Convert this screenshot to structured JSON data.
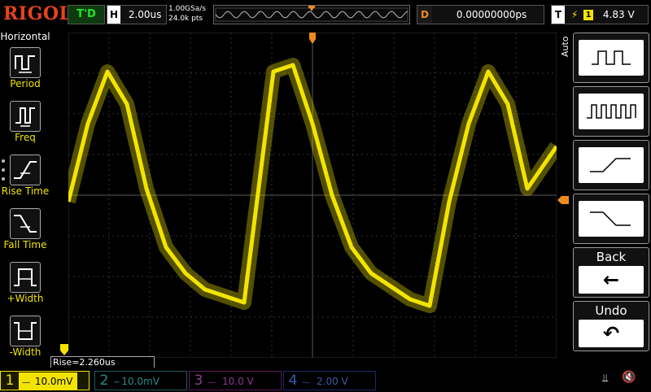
{
  "brand": "RIGOL",
  "status": "T'D",
  "horizontal": {
    "letter": "H",
    "timebase": "2.00us",
    "sample_rate": "1.00GSa/s",
    "points": "24.0k pts"
  },
  "delay": {
    "letter": "D",
    "value": "0.00000000ps"
  },
  "trigger": {
    "letter": "T",
    "edge": "⚡",
    "channel": "1",
    "level": "4.83 V",
    "marker": "T"
  },
  "left_menu": {
    "title": "Horizontal",
    "items": [
      {
        "label": "Period"
      },
      {
        "label": "Freq"
      },
      {
        "label": "Rise Time"
      },
      {
        "label": "Fall Time"
      },
      {
        "label": "+Width"
      },
      {
        "label": "-Width"
      }
    ]
  },
  "right_menu": {
    "mode_label": "Auto",
    "back_label": "Back",
    "undo_label": "Undo",
    "back_icon": "left-arrow-icon",
    "undo_icon": "undo-icon"
  },
  "measurement": "Rise=2.260us",
  "channels": [
    {
      "num": "1",
      "coupling": "—",
      "scale": "10.0mV",
      "color": "#f2e400"
    },
    {
      "num": "2",
      "coupling": "~",
      "scale": "10.0mV",
      "color": "#2a8a8a"
    },
    {
      "num": "3",
      "coupling": "—",
      "scale": "10.0 V",
      "color": "#8a3a8a"
    },
    {
      "num": "4",
      "coupling": "—",
      "scale": "2.00 V",
      "color": "#3a5aaa"
    }
  ],
  "waveform": {
    "color": "#f2e400",
    "shape": "triangle-like with rounded peaks",
    "samples": [
      [
        0,
        0.52
      ],
      [
        0.04,
        0.28
      ],
      [
        0.08,
        0.12
      ],
      [
        0.12,
        0.22
      ],
      [
        0.16,
        0.48
      ],
      [
        0.2,
        0.66
      ],
      [
        0.24,
        0.74
      ],
      [
        0.28,
        0.79
      ],
      [
        0.32,
        0.81
      ],
      [
        0.36,
        0.83
      ],
      [
        0.42,
        0.12
      ],
      [
        0.46,
        0.1
      ],
      [
        0.5,
        0.28
      ],
      [
        0.54,
        0.5
      ],
      [
        0.58,
        0.66
      ],
      [
        0.62,
        0.74
      ],
      [
        0.66,
        0.78
      ],
      [
        0.7,
        0.82
      ],
      [
        0.74,
        0.84
      ],
      [
        0.78,
        0.52
      ],
      [
        0.82,
        0.28
      ],
      [
        0.86,
        0.12
      ],
      [
        0.9,
        0.22
      ],
      [
        0.94,
        0.48
      ],
      [
        1.0,
        0.35
      ]
    ]
  },
  "icons": {
    "usb": "usb-icon",
    "speaker": "speaker-muted-icon"
  }
}
